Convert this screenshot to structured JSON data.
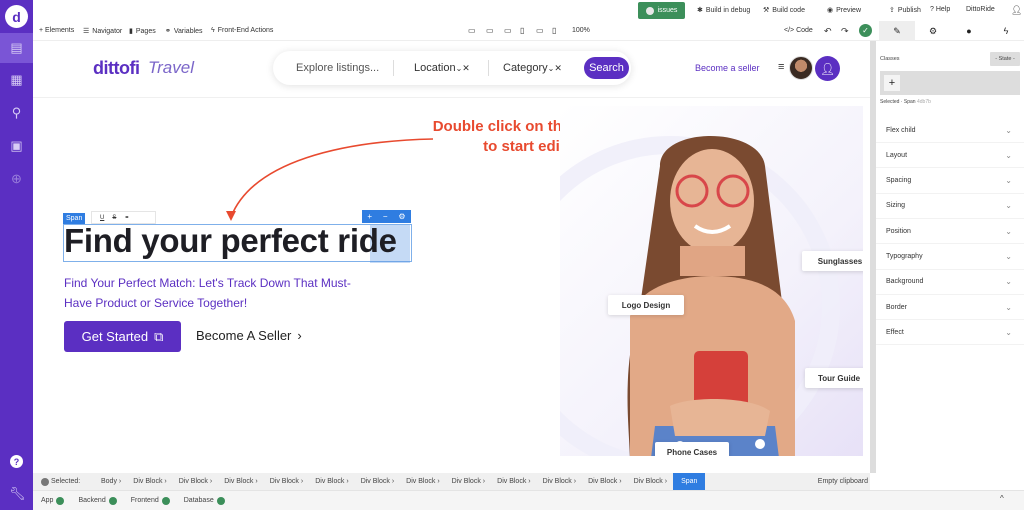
{
  "sidebar": {
    "logo": "d",
    "nav_icons": [
      "layout-icon",
      "grid-icon",
      "plug-icon",
      "database-icon",
      "globe-icon"
    ],
    "help": "?",
    "wrench": "wrench-icon"
  },
  "topbar": {
    "issues_label": "issues",
    "build_debug": "Build in debug",
    "build_code": "Build code",
    "preview": "Preview",
    "publish": "Publish",
    "help": "? Help",
    "project": "DittoRide"
  },
  "toolbar": {
    "elements": "+ Elements",
    "navigator": "Navigator",
    "pages": "Pages",
    "variables": "Variables",
    "frontend_actions": "Front-End Actions",
    "zoom": "100%",
    "code": "</> Code"
  },
  "right_panel": {
    "classes_label": "Classes",
    "state_label": "- State -",
    "add_class": "+",
    "selected_label": "Selected · Span",
    "selected_hash": "4db7b",
    "sections": [
      "Flex child",
      "Layout",
      "Spacing",
      "Sizing",
      "Position",
      "Typography",
      "Background",
      "Border",
      "Effect"
    ]
  },
  "site": {
    "brand": "dittofi",
    "brand_sub": "Travel",
    "search_placeholder": "Explore listings...",
    "location": "Location",
    "category": "Category",
    "search_btn": "Search",
    "become_seller_link": "Become a seller"
  },
  "hero": {
    "annotation": "Double click on the banner text to start editing it.",
    "span_tag": "Span",
    "format_tools": [
      "U",
      "S",
      "link"
    ],
    "title": "Find your perfect ride",
    "subtitle": "Find Your Perfect Match: Let's Track Down That Must-Have Product or Service Together!",
    "cta_primary": "Get Started",
    "cta_secondary": "Become A Seller",
    "tags": [
      "Sunglasses",
      "Logo Design",
      "Tour Guide",
      "Phone Cases"
    ]
  },
  "breadcrumb": {
    "selected_label": "Selected:",
    "items": [
      "Body",
      "Div Block",
      "Div Block",
      "Div Block",
      "Div Block",
      "Div Block",
      "Div Block",
      "Div Block",
      "Div Block",
      "Div Block",
      "Div Block",
      "Div Block",
      "Div Block",
      "Span"
    ],
    "empty_clipboard": "Empty clipboard"
  },
  "status": {
    "items": [
      "App",
      "Backend",
      "Frontend",
      "Database"
    ]
  },
  "colors": {
    "brand": "#5b2fc2",
    "success": "#3c8f5a",
    "selection": "#2f7de1",
    "annotation": "#e84a2f"
  }
}
